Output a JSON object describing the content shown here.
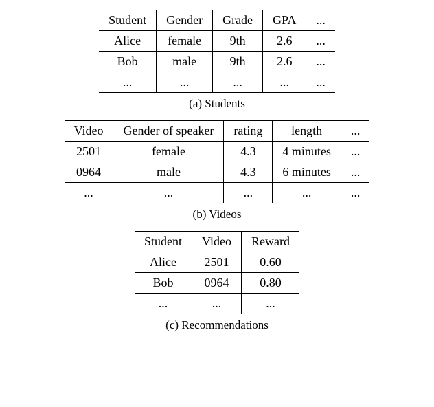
{
  "tables": {
    "students": {
      "caption": "(a) Students",
      "headers": [
        "Student",
        "Gender",
        "Grade",
        "GPA",
        "..."
      ],
      "rows": [
        [
          "Alice",
          "female",
          "9th",
          "2.6",
          "..."
        ],
        [
          "Bob",
          "male",
          "9th",
          "2.6",
          "..."
        ],
        [
          "...",
          "...",
          "...",
          "...",
          "..."
        ]
      ]
    },
    "videos": {
      "caption": "(b) Videos",
      "headers": [
        "Video",
        "Gender of speaker",
        "rating",
        "length",
        "..."
      ],
      "rows": [
        [
          "2501",
          "female",
          "4.3",
          "4 minutes",
          "..."
        ],
        [
          "0964",
          "male",
          "4.3",
          "6 minutes",
          "..."
        ],
        [
          "...",
          "...",
          "...",
          "...",
          "..."
        ]
      ]
    },
    "recommendations": {
      "caption": "(c) Recommendations",
      "headers": [
        "Student",
        "Video",
        "Reward"
      ],
      "rows": [
        [
          "Alice",
          "2501",
          "0.60"
        ],
        [
          "Bob",
          "0964",
          "0.80"
        ],
        [
          "...",
          "...",
          "..."
        ]
      ]
    }
  }
}
